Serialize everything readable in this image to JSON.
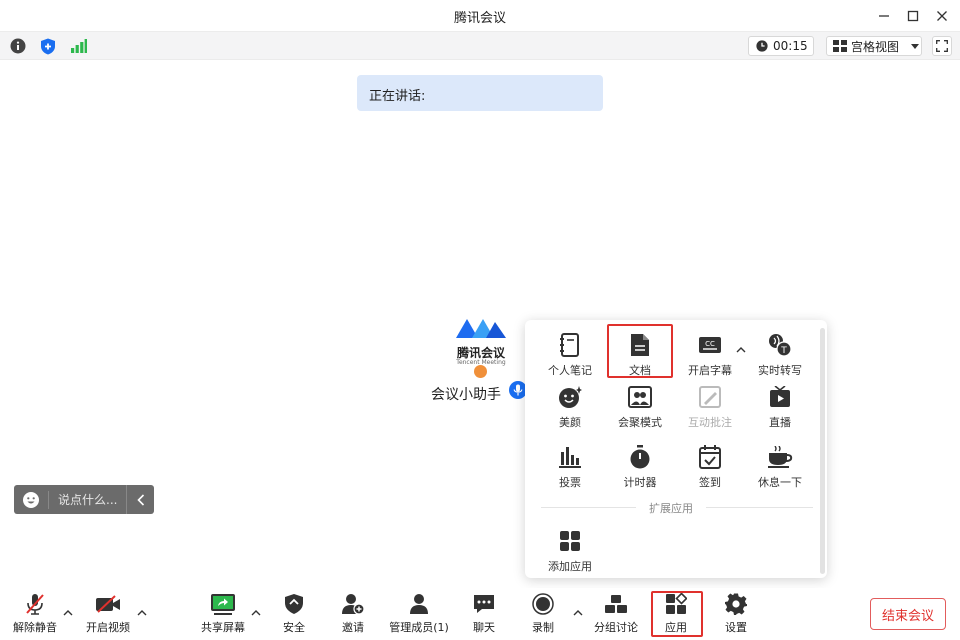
{
  "window": {
    "title": "腾讯会议"
  },
  "status": {
    "timer": "00:15",
    "view_label": "宫格视图"
  },
  "speaking": {
    "label": "正在讲话:"
  },
  "assistant": {
    "brand_cn": "腾讯会议",
    "brand_en": "Tencent Meeting",
    "name": "会议小助手"
  },
  "chat": {
    "placeholder": "说点什么..."
  },
  "apps_panel": {
    "items": [
      {
        "label": "个人笔记",
        "icon": "notebook-icon"
      },
      {
        "label": "文档",
        "icon": "document-icon",
        "highlighted": true
      },
      {
        "label": "开启字幕",
        "icon": "captions-icon"
      },
      {
        "label": "实时转写",
        "icon": "transcribe-icon"
      },
      {
        "label": "美颜",
        "icon": "beauty-icon"
      },
      {
        "label": "会聚模式",
        "icon": "together-mode-icon"
      },
      {
        "label": "互动批注",
        "icon": "annotate-icon",
        "disabled": true
      },
      {
        "label": "直播",
        "icon": "live-icon"
      },
      {
        "label": "投票",
        "icon": "poll-icon"
      },
      {
        "label": "计时器",
        "icon": "timer-icon"
      },
      {
        "label": "签到",
        "icon": "checkin-icon"
      },
      {
        "label": "休息一下",
        "icon": "coffee-icon"
      }
    ],
    "section_label": "扩展应用",
    "add_app_label": "添加应用"
  },
  "toolbar": {
    "unmute": "解除静音",
    "video": "开启视频",
    "share": "共享屏幕",
    "security": "安全",
    "invite": "邀请",
    "members": "管理成员(1)",
    "chat": "聊天",
    "record": "录制",
    "breakout": "分组讨论",
    "apps": "应用",
    "settings": "设置",
    "end": "结束会议"
  },
  "colors": {
    "accent": "#1a6ef0",
    "highlight": "#e0312d",
    "signal": "#2db84d"
  }
}
